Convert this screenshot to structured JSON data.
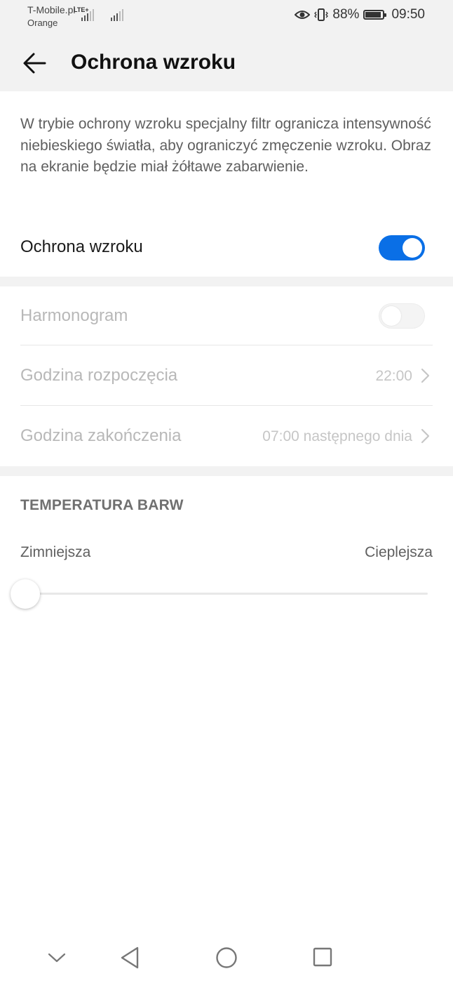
{
  "status_bar": {
    "carrier_1": "T-Mobile.pl",
    "carrier_2": "Orange",
    "network": "LTE+",
    "battery_percent": "88%",
    "battery_level": 0.88,
    "time": "09:50"
  },
  "header": {
    "title": "Ochrona wzroku"
  },
  "eye_comfort": {
    "description": "W trybie ochrony wzroku specjalny filtr ogranicza intensywność niebieskiego światła, aby ograniczyć zmęczenie wzroku. Obraz na ekranie będzie miał żółtawe zabarwienie.",
    "toggle_label": "Ochrona wzroku",
    "toggle_on": true,
    "accent_color": "#0a6fe6"
  },
  "schedule": {
    "label": "Harmonogram",
    "toggle_on": false,
    "start_label": "Godzina rozpoczęcia",
    "start_value": "22:00",
    "end_label": "Godzina zakończenia",
    "end_value": "07:00 następnego dnia"
  },
  "color_temperature": {
    "section_title": "TEMPERATURA BARW",
    "min_label": "Zimniejsza",
    "max_label": "Cieplejsza",
    "slider_value": 0
  },
  "nav_bar": {
    "icons": [
      "chevron-down-icon",
      "back-triangle-icon",
      "home-circle-icon",
      "recents-square-icon"
    ]
  }
}
